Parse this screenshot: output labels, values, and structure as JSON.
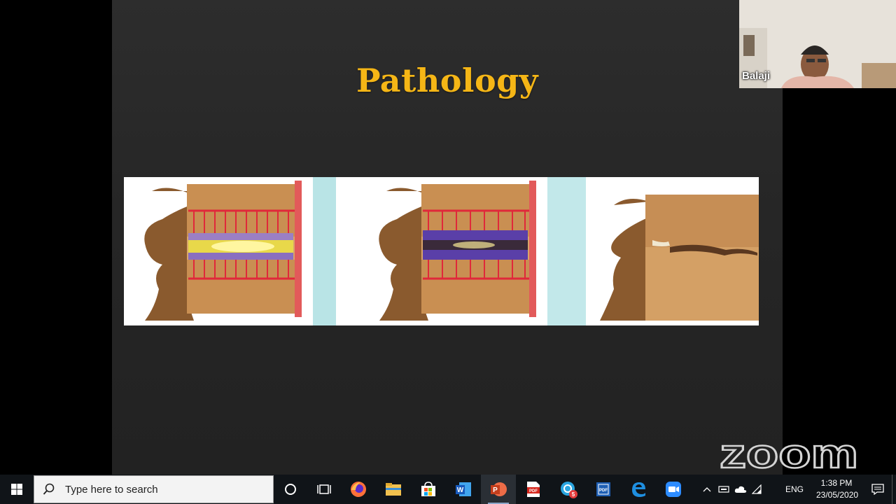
{
  "slide": {
    "title": "Pathology"
  },
  "video": {
    "participant_name": "Balaji"
  },
  "watermark": {
    "brand": "zoom"
  },
  "taskbar": {
    "search_placeholder": "Type here to search",
    "apps": [
      {
        "icon": "cortana-icon"
      },
      {
        "icon": "task-view-icon"
      },
      {
        "icon": "firefox-icon"
      },
      {
        "icon": "file-explorer-icon"
      },
      {
        "icon": "microsoft-store-icon"
      },
      {
        "icon": "word-icon"
      },
      {
        "icon": "powerpoint-icon"
      },
      {
        "icon": "acrobat-icon"
      },
      {
        "icon": "messaging-app-icon",
        "badge": "5"
      },
      {
        "icon": "pdf-app-icon"
      },
      {
        "icon": "edge-icon"
      },
      {
        "icon": "zoom-icon"
      }
    ],
    "tray": {
      "language": "ENG",
      "time": "1:38 PM",
      "date": "23/05/2020"
    }
  },
  "colors": {
    "title": "#f5b616",
    "taskbar": "#101418",
    "slide_bg": "#2a2a2a"
  }
}
